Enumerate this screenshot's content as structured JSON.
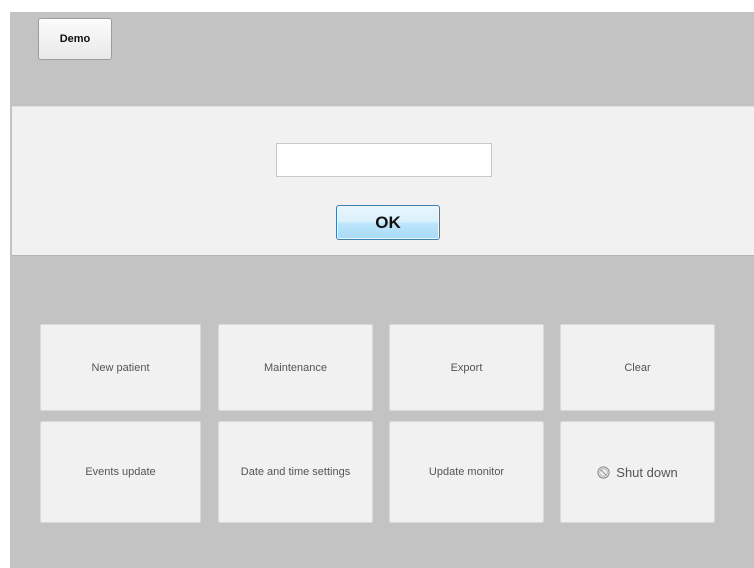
{
  "top": {
    "demo_label": "Demo"
  },
  "login": {
    "input_value": "",
    "input_placeholder": "",
    "ok_label": "OK"
  },
  "menu": {
    "new_patient": "New patient",
    "maintenance": "Maintenance",
    "export": "Export",
    "clear": "Clear",
    "events_update": "Events update",
    "date_time_settings": "Date and time settings",
    "update_monitor": "Update monitor",
    "shut_down": "Shut down",
    "shut_down_icon": "power-icon"
  },
  "colors": {
    "background": "#c3c3c3",
    "panel": "#f1f1f1",
    "ok_button_top": "#eaf6fd",
    "ok_button_bottom": "#a7d9f5",
    "ok_button_border": "#3c7fb1"
  }
}
